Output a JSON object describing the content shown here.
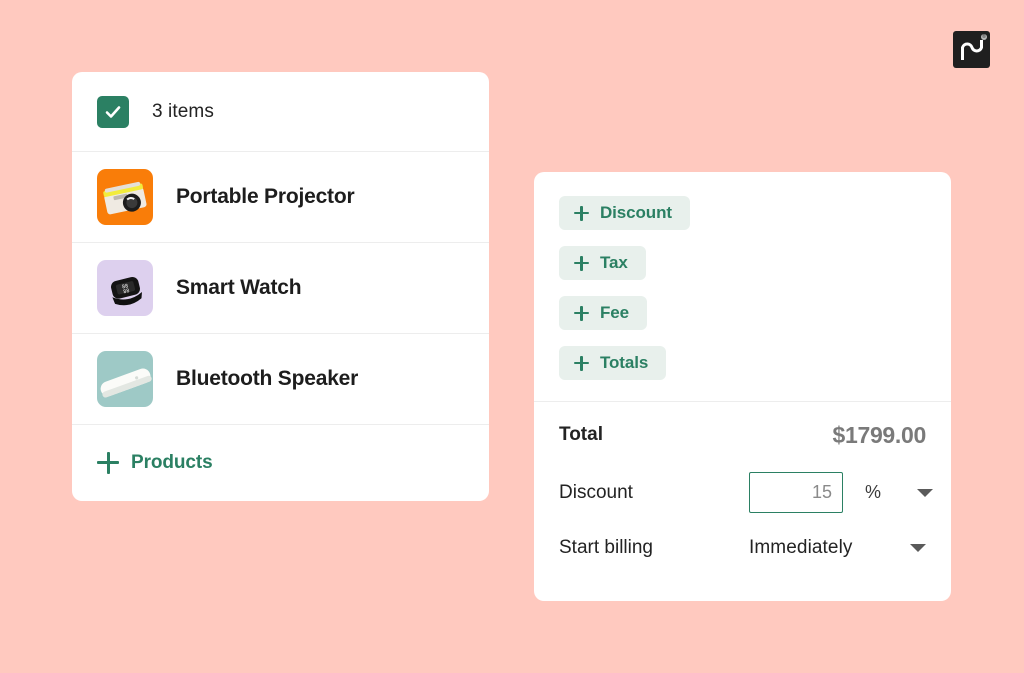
{
  "brand": {
    "logo_name": "pandadoc-logo",
    "logo_text": "pd",
    "registered_mark": "®",
    "logo_bg": "#1f1f1f"
  },
  "theme": {
    "page_background": "#ffc9bf",
    "card_background": "#ffffff",
    "accent_green": "#2b8063",
    "chip_background": "#e8f0ec",
    "divider": "#ededed",
    "muted_text": "#7a7a7a"
  },
  "products_card": {
    "header": {
      "checkbox_icon": "checkmark-icon",
      "checked": true,
      "label": "3 items"
    },
    "items": [
      {
        "name": "Portable Projector",
        "thumb_name": "portable-projector-thumbnail",
        "thumb_bg": "#f97d09"
      },
      {
        "name": "Smart Watch",
        "thumb_name": "smart-watch-thumbnail",
        "thumb_bg": "#ddd0ee"
      },
      {
        "name": "Bluetooth Speaker",
        "thumb_name": "bluetooth-speaker-thumbnail",
        "thumb_bg": "#9ec9c6"
      }
    ],
    "add_products": {
      "icon": "plus-icon",
      "label": "Products"
    }
  },
  "pricing_card": {
    "chips": [
      {
        "icon": "plus-icon",
        "label": "Discount"
      },
      {
        "icon": "plus-icon",
        "label": "Tax"
      },
      {
        "icon": "plus-icon",
        "label": "Fee"
      },
      {
        "icon": "plus-icon",
        "label": "Totals"
      }
    ],
    "total": {
      "label": "Total",
      "value": "$1799.00"
    },
    "discount": {
      "label": "Discount",
      "value": "15",
      "placeholder": "0",
      "unit": "%",
      "unit_caret_icon": "chevron-down-icon"
    },
    "start_billing": {
      "label": "Start billing",
      "value": "Immediately",
      "caret_icon": "chevron-down-icon"
    }
  }
}
